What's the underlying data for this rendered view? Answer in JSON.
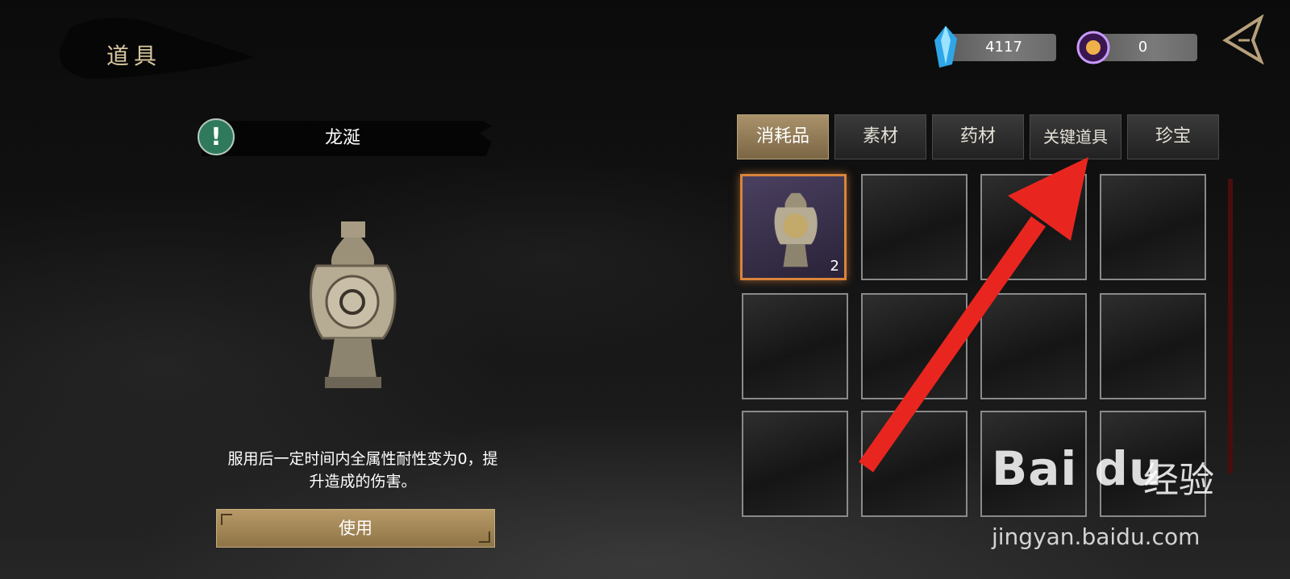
{
  "header": {
    "title": "道具",
    "currency_gem": "4117",
    "currency_orb": "0"
  },
  "item": {
    "name": "龙涎",
    "description_line1": "服用后一定时间内全属性耐性变为0，提",
    "description_line2": "升造成的伤害。",
    "use_label": "使用"
  },
  "tabs": [
    {
      "label": "消耗品",
      "active": true
    },
    {
      "label": "素材",
      "active": false
    },
    {
      "label": "药材",
      "active": false
    },
    {
      "label": "关键道具",
      "active": false
    },
    {
      "label": "珍宝",
      "active": false
    }
  ],
  "inventory": {
    "slots": [
      {
        "item": "vase",
        "count": "2",
        "selected": true
      },
      {},
      {},
      {},
      {},
      {},
      {},
      {},
      {},
      {},
      {},
      {}
    ]
  },
  "watermark": {
    "logo": "Bai du",
    "cn": "经验",
    "url": "jingyan.baidu.com"
  },
  "colors": {
    "accent_gold": "#a9926a",
    "selected_orange": "#d9843a",
    "annotation_red": "#e8261f"
  }
}
